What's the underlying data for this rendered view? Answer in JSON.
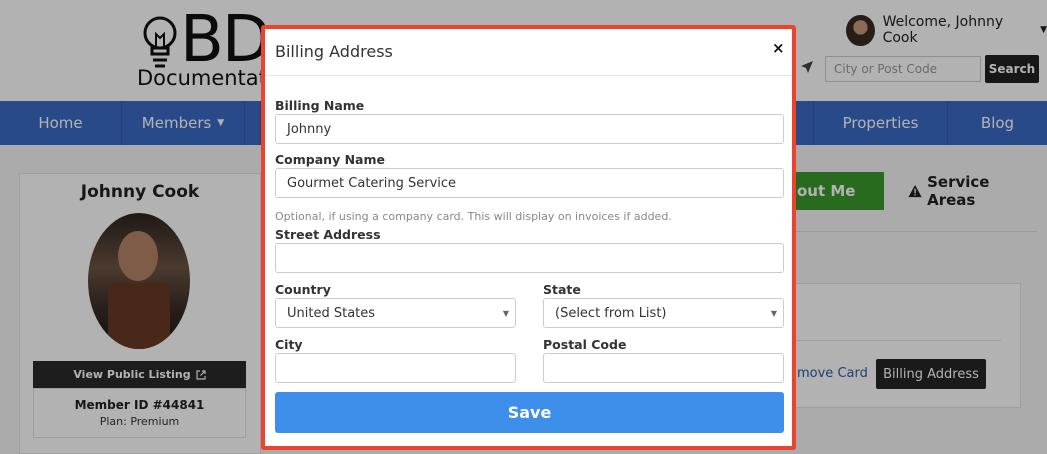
{
  "header": {
    "logo_letters": "BD",
    "logo_subtitle": "Documentati",
    "welcome_text": "Welcome, Johnny Cook",
    "city_placeholder": "City or Post Code",
    "search_label": "Search"
  },
  "nav": {
    "items": [
      "Home",
      "Members",
      "Properties",
      "Blog"
    ]
  },
  "profile": {
    "name": "Johnny Cook",
    "view_listing": "View Public Listing",
    "member_id": "Member ID #44841",
    "plan": "Plan: Premium"
  },
  "content": {
    "about_tab": "out Me",
    "service_areas_tab": "Service Areas",
    "remove_card": "move Card",
    "billing_address_button": "Billing Address"
  },
  "modal": {
    "title": "Billing Address",
    "close": "×",
    "billing_name_label": "Billing Name",
    "billing_name_value": "Johnny",
    "company_name_label": "Company Name",
    "company_name_value": "Gourmet Catering Service",
    "company_help": "Optional, if using a company card. This will display on invoices if added.",
    "street_label": "Street Address",
    "street_value": "",
    "country_label": "Country",
    "country_value": "United States",
    "state_label": "State",
    "state_value": "(Select from List)",
    "city_label": "City",
    "city_value": "",
    "postal_label": "Postal Code",
    "postal_value": "",
    "save_label": "Save"
  },
  "colors": {
    "nav_blue": "#3b6bc5",
    "modal_border": "#e8442e",
    "save_blue": "#3e8fe9",
    "about_green": "#3a9a2c"
  }
}
